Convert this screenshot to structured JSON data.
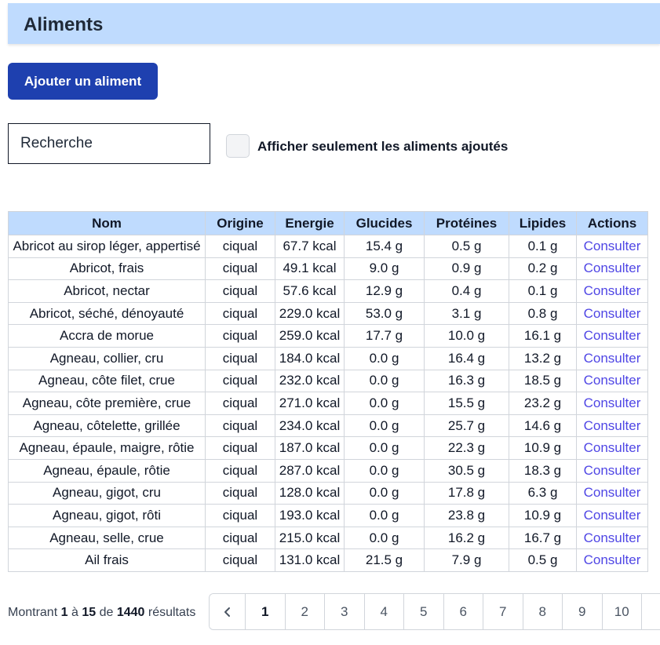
{
  "header": {
    "title": "Aliments"
  },
  "actions": {
    "add_label": "Ajouter un aliment"
  },
  "filters": {
    "search_placeholder": "Recherche",
    "only_added_label": "Afficher seulement les aliments ajoutés"
  },
  "table": {
    "columns": [
      "Nom",
      "Origine",
      "Energie",
      "Glucides",
      "Protéines",
      "Lipides",
      "Actions"
    ],
    "action_label": "Consulter",
    "rows": [
      [
        "Abricot au sirop léger, appertisé",
        "ciqual",
        "67.7 kcal",
        "15.4 g",
        "0.5 g",
        "0.1 g"
      ],
      [
        "Abricot, frais",
        "ciqual",
        "49.1 kcal",
        "9.0 g",
        "0.9 g",
        "0.2 g"
      ],
      [
        "Abricot, nectar",
        "ciqual",
        "57.6 kcal",
        "12.9 g",
        "0.4 g",
        "0.1 g"
      ],
      [
        "Abricot, séché, dénoyauté",
        "ciqual",
        "229.0 kcal",
        "53.0 g",
        "3.1 g",
        "0.8 g"
      ],
      [
        "Accra de morue",
        "ciqual",
        "259.0 kcal",
        "17.7 g",
        "10.0 g",
        "16.1 g"
      ],
      [
        "Agneau, collier, cru",
        "ciqual",
        "184.0 kcal",
        "0.0 g",
        "16.4 g",
        "13.2 g"
      ],
      [
        "Agneau, côte filet, crue",
        "ciqual",
        "232.0 kcal",
        "0.0 g",
        "16.3 g",
        "18.5 g"
      ],
      [
        "Agneau, côte première, crue",
        "ciqual",
        "271.0 kcal",
        "0.0 g",
        "15.5 g",
        "23.2 g"
      ],
      [
        "Agneau, côtelette, grillée",
        "ciqual",
        "234.0 kcal",
        "0.0 g",
        "25.7 g",
        "14.6 g"
      ],
      [
        "Agneau, épaule, maigre, rôtie",
        "ciqual",
        "187.0 kcal",
        "0.0 g",
        "22.3 g",
        "10.9 g"
      ],
      [
        "Agneau, épaule, rôtie",
        "ciqual",
        "287.0 kcal",
        "0.0 g",
        "30.5 g",
        "18.3 g"
      ],
      [
        "Agneau, gigot, cru",
        "ciqual",
        "128.0 kcal",
        "0.0 g",
        "17.8 g",
        "6.3 g"
      ],
      [
        "Agneau, gigot, rôti",
        "ciqual",
        "193.0 kcal",
        "0.0 g",
        "23.8 g",
        "10.9 g"
      ],
      [
        "Agneau, selle, crue",
        "ciqual",
        "215.0 kcal",
        "0.0 g",
        "16.2 g",
        "16.7 g"
      ],
      [
        "Ail frais",
        "ciqual",
        "131.0 kcal",
        "21.5 g",
        "7.9 g",
        "0.5 g"
      ]
    ]
  },
  "footer": {
    "showing_prefix": "Montrant",
    "from": "1",
    "to_word": "à",
    "to": "15",
    "of_word": "de",
    "total": "1440",
    "results_word": "résultats"
  },
  "pagination": {
    "prev_icon": "chevron-left-icon",
    "pages": [
      "1",
      "2",
      "3",
      "4",
      "5",
      "6",
      "7",
      "8",
      "9",
      "10"
    ],
    "current": "1"
  }
}
